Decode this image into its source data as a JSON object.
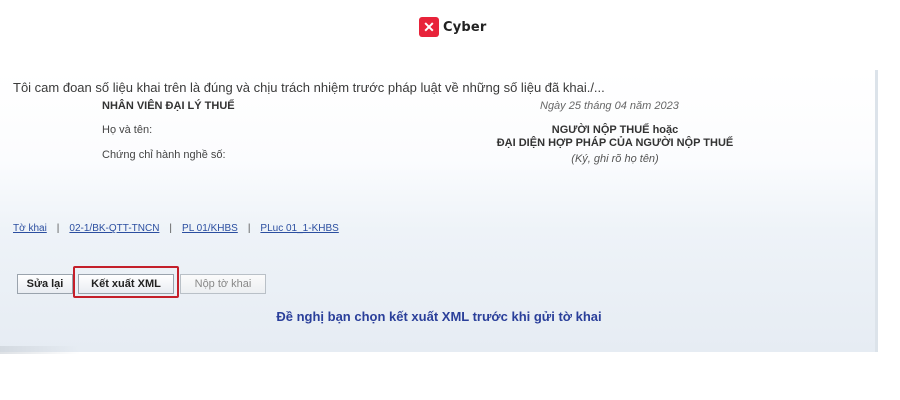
{
  "logo": {
    "mark": "✕",
    "text": "Cyber"
  },
  "form": {
    "declaration": "Tôi cam đoan số liệu khai trên là đúng và chịu trách nhiệm trước pháp luật về những số liệu đã khai./...",
    "agent_title": "NHÂN VIÊN ĐẠI LÝ THUẾ",
    "date": "Ngày 25 tháng 04 năm 2023",
    "name_label": "Họ và tên:",
    "certificate_label": "Chứng chỉ hành nghề số:",
    "signer_line1": "NGƯỜI NỘP THUẾ hoặc",
    "signer_line2": "ĐẠI DIỆN HỢP PHÁP CỦA NGƯỜI NỘP THUẾ",
    "signer_note": "(Ký, ghi rõ họ tên)"
  },
  "links": [
    "Tờ khai",
    "02-1/BK-QTT-TNCN",
    "PL 01/KHBS",
    "PLuc 01_1-KHBS"
  ],
  "buttons": {
    "edit": "Sửa lại",
    "export_xml": "Kết xuất XML",
    "submit": "Nộp tờ khai"
  },
  "notice": "Đề nghị bạn chọn kết xuất XML trước khi gửi tờ khai",
  "colors": {
    "highlight": "#c41f2a",
    "link": "#2b4ea0",
    "notice": "#2a3f9a",
    "logo": "#e8233a"
  }
}
